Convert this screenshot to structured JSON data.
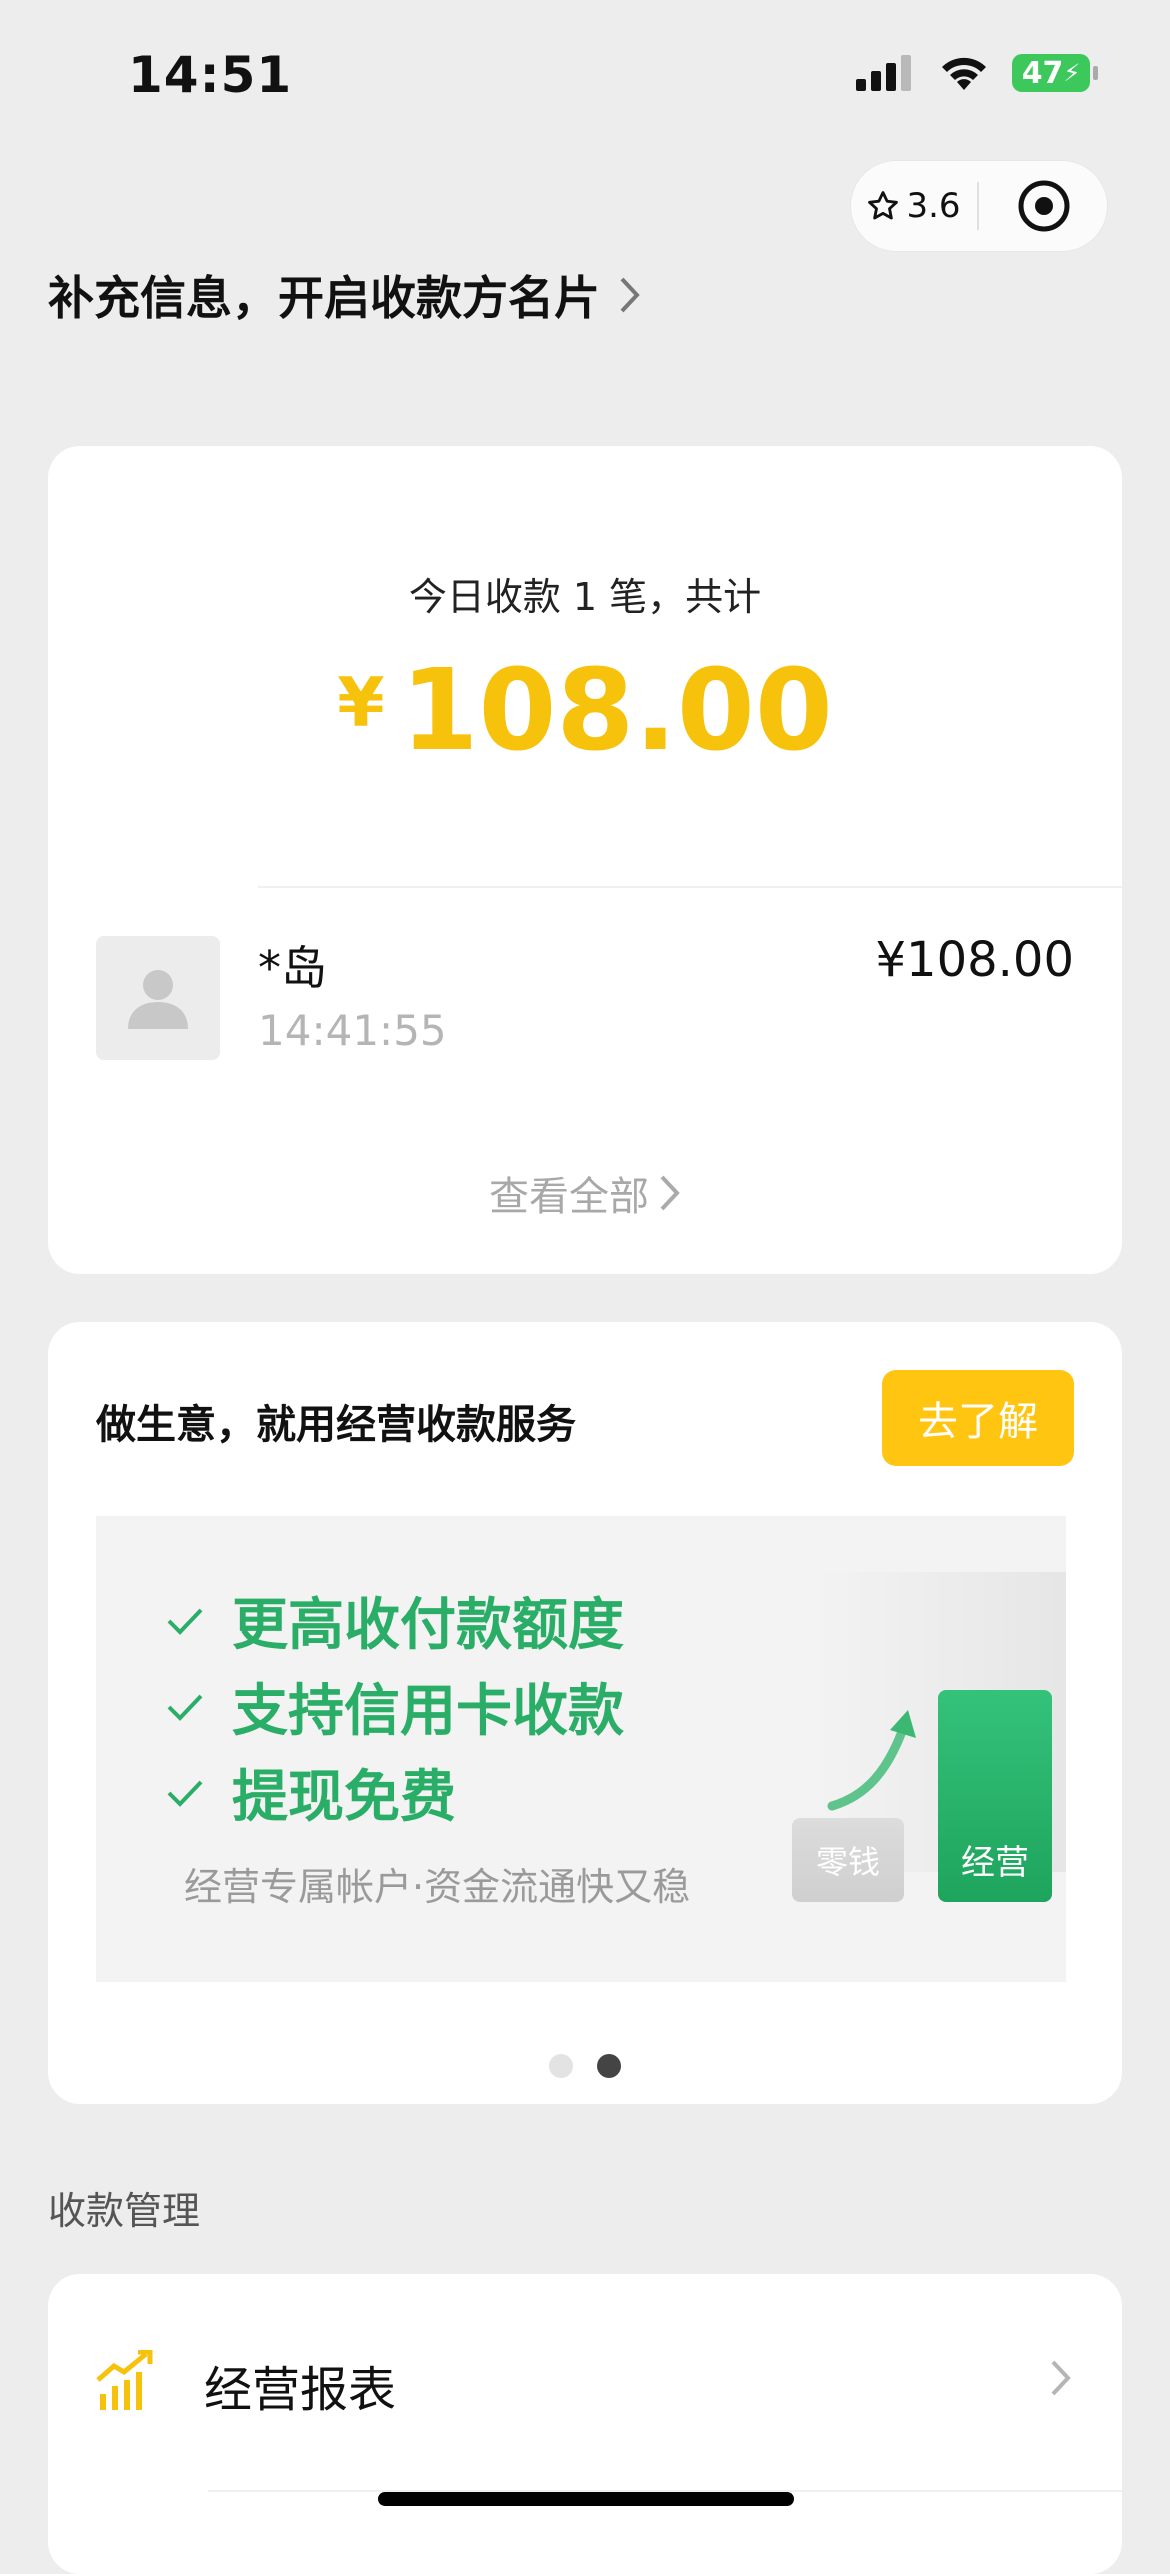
{
  "status_bar": {
    "time": "14:51",
    "battery": "47"
  },
  "capsule": {
    "rating": "3.6"
  },
  "promo_link": "补充信息，开启收款方名片",
  "summary": {
    "line": "今日收款 1 笔，共计",
    "currency": "¥",
    "amount": "108.00",
    "payment": {
      "name": "*岛",
      "time": "14:41:55",
      "amount": "¥108.00"
    },
    "view_all": "查看全部"
  },
  "service": {
    "title": "做生意，就用经营收款服务",
    "button": "去了解",
    "features": [
      "更高收付款额度",
      "支持信用卡收款",
      "提现免费"
    ],
    "subtitle": "经营专属帐户·资金流通快又稳",
    "tag_change": "零钱",
    "tag_business": "经营",
    "carousel": {
      "count": 2,
      "active": 2
    }
  },
  "management": {
    "title": "收款管理",
    "items": [
      {
        "label": "经营报表"
      }
    ]
  },
  "colors": {
    "accent_yellow": "#ffc510",
    "amount_yellow": "#f7c20b",
    "green": "#2aae67",
    "background": "#ededed"
  }
}
